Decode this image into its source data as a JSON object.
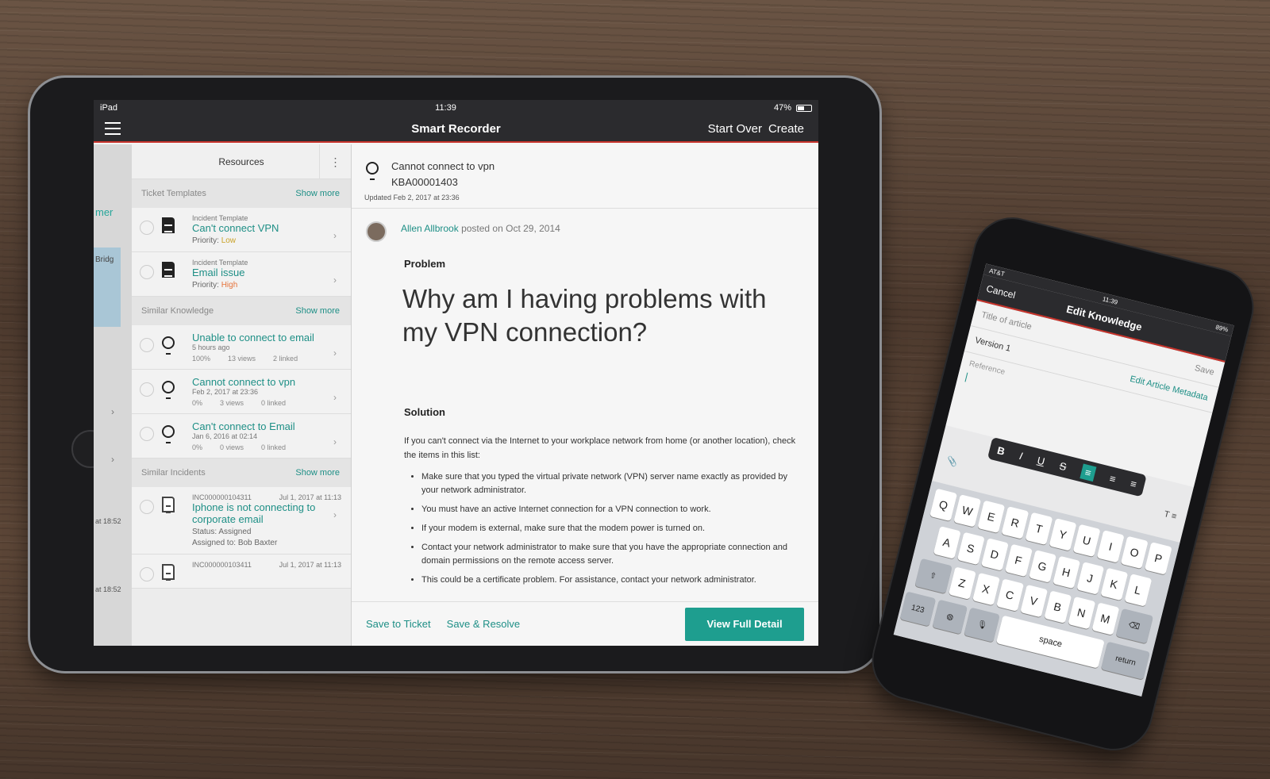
{
  "ipad": {
    "status": {
      "device": "iPad",
      "time": "11:39",
      "battery": "47%"
    },
    "nav": {
      "title": "Smart Recorder",
      "start_over": "Start Over",
      "create": "Create"
    },
    "left_strip": {
      "text": "mer",
      "map_label": "Bridg",
      "time1": "at 18:52",
      "time2": "at 18:52"
    },
    "resources": {
      "title": "Resources",
      "ticket_templates": {
        "label": "Ticket Templates",
        "more": "Show more",
        "items": [
          {
            "type": "Incident Template",
            "title": "Can't connect VPN",
            "priority_label": "Priority:",
            "priority": "Low"
          },
          {
            "type": "Incident Template",
            "title": "Email issue",
            "priority_label": "Priority:",
            "priority": "High"
          }
        ]
      },
      "similar_knowledge": {
        "label": "Similar Knowledge",
        "more": "Show more",
        "items": [
          {
            "title": "Unable to connect to email",
            "time": "5 hours ago",
            "rating": "100%",
            "views": "13 views",
            "linked": "2 linked"
          },
          {
            "title": "Cannot connect to vpn",
            "time": "Feb 2, 2017 at 23:36",
            "rating": "0%",
            "views": "3 views",
            "linked": "0 linked"
          },
          {
            "title": "Can't connect to Email",
            "time": "Jan 6, 2016 at 02:14",
            "rating": "0%",
            "views": "0 views",
            "linked": "0 linked"
          }
        ]
      },
      "similar_incidents": {
        "label": "Similar Incidents",
        "more": "Show more",
        "items": [
          {
            "number": "INC000000104311",
            "date": "Jul 1, 2017 at 11:13",
            "title": "Iphone is not connecting to corporate email",
            "status": "Status: Assigned",
            "assigned": "Assigned to: Bob Baxter"
          },
          {
            "number": "INC000000103411",
            "date": "Jul 1, 2017 at 11:13"
          }
        ]
      }
    },
    "article": {
      "title": "Cannot connect to vpn",
      "id": "KBA00001403",
      "updated": "Updated Feb 2, 2017 at 23:36",
      "author": "Allen Allbrook",
      "posted": "posted on Oct 29, 2014",
      "problem_label": "Problem",
      "question": "Why am I having problems with my VPN connection?",
      "solution_label": "Solution",
      "intro": "If you can't connect via the Internet to your workplace network from home (or another location), check the items in this list:",
      "bullets": [
        "Make sure that you typed the virtual private network (VPN) server name exactly as provided by your network administrator.",
        "You must have an active Internet connection for a VPN connection to work.",
        "If your modem is external, make sure that the modem power is turned on.",
        "Contact your network administrator to make sure that you have the appropriate connection and domain permissions on the remote access server.",
        "This could be a certificate problem. For assistance, contact your network administrator."
      ]
    },
    "footer": {
      "save_ticket": "Save to Ticket",
      "save_resolve": "Save & Resolve",
      "view_detail": "View Full Detail"
    }
  },
  "iphone": {
    "status": {
      "carrier": "AT&T",
      "time": "11:39",
      "battery": "89%"
    },
    "nav": {
      "cancel": "Cancel",
      "title": "Edit Knowledge",
      "save": "Save"
    },
    "title_placeholder": "Title of article",
    "version": "Version 1",
    "edit_meta": "Edit Article Metadata",
    "reference_placeholder": "Reference",
    "format": [
      "B",
      "I",
      "U",
      "S"
    ],
    "keys_row1": [
      "Q",
      "W",
      "E",
      "R",
      "T",
      "Y",
      "U",
      "I",
      "O",
      "P"
    ],
    "keys_row2": [
      "A",
      "S",
      "D",
      "F",
      "G",
      "H",
      "J",
      "K",
      "L"
    ],
    "keys_row3": [
      "Z",
      "X",
      "C",
      "V",
      "B",
      "N",
      "M"
    ],
    "key_123": "123",
    "key_space": "space",
    "key_return": "return"
  },
  "colors": {
    "accent": "#1e9e8f",
    "nav": "#2b2b2e",
    "brand_red": "#c8342c",
    "priority_low": "#c9a227",
    "priority_high": "#e5733b"
  }
}
